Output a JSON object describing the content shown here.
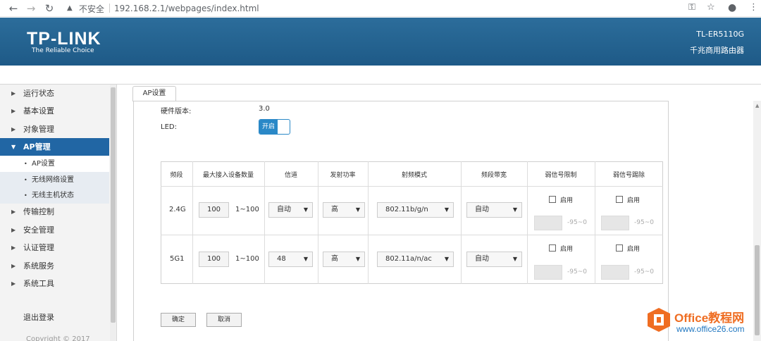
{
  "browser": {
    "back_icon": "←",
    "forward_icon": "→",
    "reload_icon": "↻",
    "warning_icon": "▲",
    "security_label": "不安全",
    "url": "192.168.2.1/webpages/index.html",
    "key_icon": "⚿",
    "star_icon": "☆",
    "account_icon": "●",
    "menu_icon": "⋮"
  },
  "header": {
    "logo": "TP-LINK",
    "tagline": "The Reliable Choice",
    "model": "TL-ER5110G",
    "subtitle": "千兆商用路由器"
  },
  "sidebar": {
    "items": [
      {
        "label": "运行状态"
      },
      {
        "label": "基本设置"
      },
      {
        "label": "对象管理"
      },
      {
        "label": "AP管理"
      },
      {
        "label": "传输控制"
      },
      {
        "label": "安全管理"
      },
      {
        "label": "认证管理"
      },
      {
        "label": "系统服务"
      },
      {
        "label": "系统工具"
      }
    ],
    "sub_items": [
      {
        "label": "AP设置"
      },
      {
        "label": "无线网络设置"
      },
      {
        "label": "无线主机状态"
      }
    ],
    "logout": "退出登录",
    "copyright": "Copyright © 2017"
  },
  "tab": {
    "label": "AP设置"
  },
  "form": {
    "hw_label": "硬件版本:",
    "hw_value": "3.0",
    "led_label": "LED:",
    "led_toggle": "开启"
  },
  "table": {
    "headers": [
      "频段",
      "最大接入设备数量",
      "信道",
      "发射功率",
      "射频模式",
      "频段带宽",
      "弱信号限制",
      "弱信号踢除"
    ],
    "rows": [
      {
        "band": "2.4G",
        "max_devices": "100",
        "range": "1~100",
        "channel": "自动",
        "power": "高",
        "mode": "802.11b/g/n",
        "bandwidth": "自动",
        "limit_enable": "启用",
        "limit_range": "-95~0",
        "kick_enable": "启用",
        "kick_range": "-95~0"
      },
      {
        "band": "5G1",
        "max_devices": "100",
        "range": "1~100",
        "channel": "48",
        "power": "高",
        "mode": "802.11a/n/ac",
        "bandwidth": "自动",
        "limit_enable": "启用",
        "limit_range": "-95~0",
        "kick_enable": "启用",
        "kick_range": "-95~0"
      }
    ]
  },
  "buttons": {
    "confirm": "确定",
    "cancel": "取消"
  },
  "watermark": {
    "title": "Office教程网",
    "url": "www.office26.com"
  }
}
